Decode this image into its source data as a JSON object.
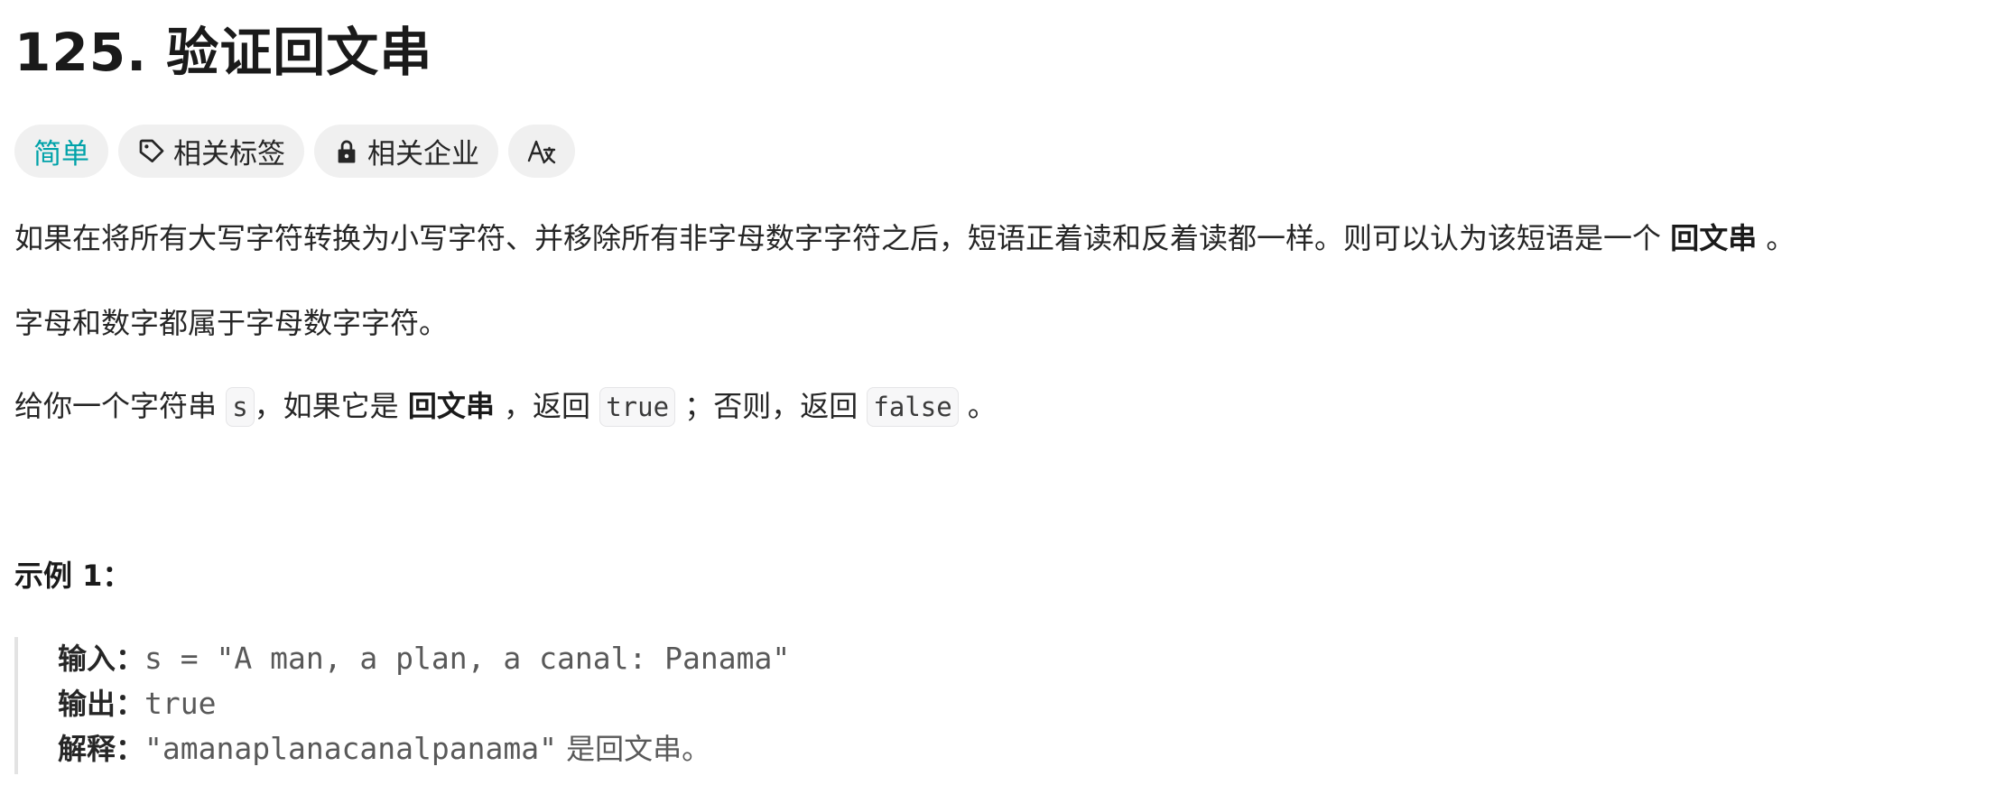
{
  "problem": {
    "title": "125. 验证回文串",
    "difficulty": "简单",
    "tags_label": "相关标签",
    "companies_label": "相关企业",
    "translate_label": "A文"
  },
  "description": {
    "p1_text": "如果在将所有大写字符转换为小写字符、并移除所有非字母数字字符之后，短语正着读和反着读都一样。则可以认为该短语是一个 ",
    "p1_bold": "回文串",
    "p1_end": " 。",
    "p2": "字母和数字都属于字母数字字符。",
    "p3_a": "给你一个字符串 ",
    "p3_code_s": "s",
    "p3_b": "，如果它是 ",
    "p3_bold": "回文串",
    "p3_c": " ，返回 ",
    "p3_code_true": "true",
    "p3_d": " ；否则，返回 ",
    "p3_code_false": "false",
    "p3_e": " 。"
  },
  "example": {
    "title": "示例 1：",
    "input_label": "输入：",
    "input_value": "s = \"A man, a plan, a canal: Panama\"",
    "output_label": "输出：",
    "output_value": "true",
    "explain_label": "解释：",
    "explain_value": "\"amanaplanacanalpanama\"",
    "explain_suffix": " 是回文串。"
  },
  "colors": {
    "easy": "#00a2a9",
    "tag_bg": "#f0f0f0"
  },
  "icons": {
    "tags": "tag-icon",
    "companies": "lock-icon",
    "translate": "translate-icon"
  }
}
